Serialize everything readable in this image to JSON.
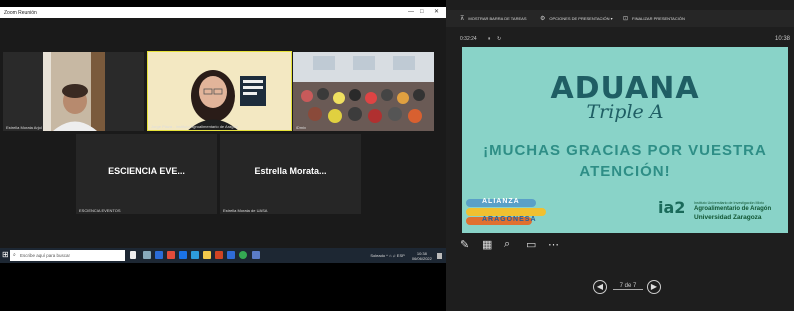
{
  "zoom": {
    "window_title": "Zoom Reunión",
    "min": "—",
    "max": "□",
    "close": "✕",
    "participants": [
      {
        "name": "Estrella Morata Arjol"
      },
      {
        "name": "Jorge Plaza - Instituto Agroalimentario de Aragón"
      },
      {
        "name": "iDmix"
      },
      {
        "name": "ESCIENCIA EVENTOS",
        "display": "ESCIENCIA  EVE..."
      },
      {
        "name": "Estrella Morata de UASA",
        "display": "Estrella  Morata..."
      }
    ],
    "taskbar": {
      "search_placeholder": "Escribe aquí para buscar",
      "tray": "Soleado  ^  ⌂  ♫  ESP",
      "time": "10:38",
      "date": "06/06/2022"
    }
  },
  "presenter": {
    "toolbar": {
      "show_taskbar": "MOSTRAR BARRA DE TAREAS",
      "options": "OPCIONES DE PRESENTACIÓN ▾",
      "end": "FINALIZAR PRESENTACIÓN"
    },
    "timer": "0:32:24",
    "clock": "10:38",
    "slide": {
      "title": "ADUANA",
      "subtitle": "Triple A",
      "thanks_line1": "¡MUCHAS GRACIAS POR VUESTRA",
      "thanks_line2": "ATENCIÓN!",
      "alianza_1": "ALIANZA",
      "alianza_2": "ARAGONESA",
      "ia2_logo": "ia2",
      "ia2_line1": "Instituto Universitario de Investigación Mixto",
      "ia2_line2": "Agroalimentario de Aragón",
      "ia2_line3": "Universidad Zaragoza"
    },
    "slide_counter": "7 de 7"
  },
  "colors": {
    "slide_bg": "#89d3c8",
    "slide_dark": "#1f5e64",
    "slide_accent": "#2e8e86",
    "taskbar": "#1d2733"
  }
}
